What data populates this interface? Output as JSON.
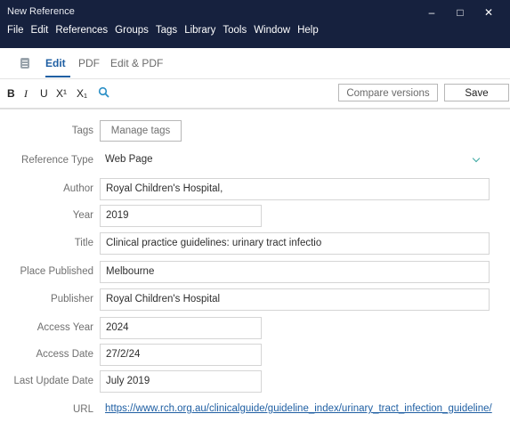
{
  "window": {
    "title": "New Reference",
    "controls": {
      "minimize": "–",
      "maximize": "□",
      "close": "✕"
    }
  },
  "menu": [
    "File",
    "Edit",
    "References",
    "Groups",
    "Tags",
    "Library",
    "Tools",
    "Window",
    "Help"
  ],
  "tabs": [
    {
      "label": "Edit",
      "active": true
    },
    {
      "label": "PDF",
      "active": false
    },
    {
      "label": "Edit & PDF",
      "active": false
    }
  ],
  "toolbar": {
    "format": [
      "B",
      "I",
      "U",
      "X¹",
      "X₁"
    ],
    "compare_label": "Compare versions",
    "save_label": "Save"
  },
  "form": {
    "tags": {
      "label": "Tags",
      "button": "Manage tags"
    },
    "reference_type": {
      "label": "Reference Type",
      "value": "Web Page"
    },
    "author": {
      "label": "Author",
      "value": "Royal Children's Hospital,"
    },
    "year": {
      "label": "Year",
      "value": "2019"
    },
    "title": {
      "label": "Title",
      "value": "Clinical practice guidelines: urinary tract infectio"
    },
    "place_published": {
      "label": "Place Published",
      "value": "Melbourne"
    },
    "publisher": {
      "label": "Publisher",
      "value": "Royal Children's Hospital"
    },
    "access_year": {
      "label": "Access Year",
      "value": "2024"
    },
    "access_date": {
      "label": "Access Date",
      "value": "27/2/24"
    },
    "last_update_date": {
      "label": "Last Update Date",
      "value": "July 2019"
    },
    "url": {
      "label": "URL",
      "value": "https://www.rch.org.au/clinicalguide/guideline_index/urinary_tract_infection_guideline/"
    }
  },
  "colors": {
    "titlebar": "#16213e",
    "accent": "#1f5fa3",
    "chevron": "#3aa7a1"
  }
}
